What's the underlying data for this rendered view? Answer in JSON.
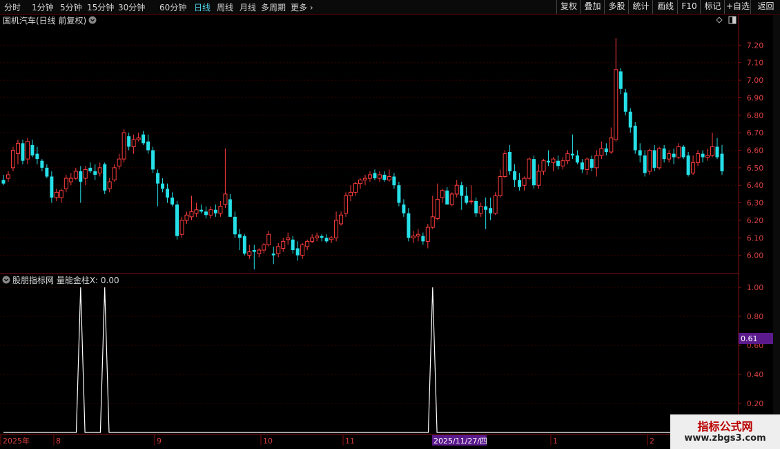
{
  "toolbar": {
    "periods": [
      "分时",
      "1分钟",
      "5分钟",
      "15分钟",
      "30分钟",
      "60分钟",
      "日线",
      "周线",
      "月线",
      "多周期",
      "更多"
    ],
    "active_period": "日线",
    "right_buttons": [
      "复权",
      "叠加",
      "多股",
      "统计",
      "画线",
      "F10",
      "标记",
      "+自选",
      "返回"
    ]
  },
  "main_panel": {
    "title": "国机汽车(日线 前复权)"
  },
  "indicator_panel": {
    "title": "股朋指标网 量能金柱X: 0.00",
    "cursor_value": "0.61"
  },
  "date_axis": {
    "labels": [
      "2025年",
      "8",
      "9",
      "10",
      "11",
      "2025/11/27/四",
      "1",
      "2"
    ]
  },
  "colors": {
    "up": "#ff3d3d",
    "down": "#26e0e8",
    "grid": "#3a0000",
    "axis_text": "#d84040",
    "highlight": "#5a1a8c"
  },
  "watermark": {
    "line1": "指标公式网",
    "line2": "www.zbgs3.com"
  },
  "chart_data": [
    {
      "type": "candlestick",
      "title": "国机汽车(日线 前复权)",
      "ylim": [
        5.9,
        7.3
      ],
      "yticks": [
        6.0,
        6.1,
        6.2,
        6.3,
        6.4,
        6.5,
        6.6,
        6.7,
        6.8,
        6.9,
        7.0,
        7.1,
        7.2
      ],
      "candles": [
        [
          6.43,
          6.46,
          6.4,
          6.41
        ],
        [
          6.44,
          6.48,
          6.42,
          6.46
        ],
        [
          6.5,
          6.62,
          6.48,
          6.6
        ],
        [
          6.58,
          6.66,
          6.52,
          6.64
        ],
        [
          6.64,
          6.66,
          6.52,
          6.54
        ],
        [
          6.55,
          6.67,
          6.52,
          6.65
        ],
        [
          6.63,
          6.66,
          6.56,
          6.57
        ],
        [
          6.58,
          6.62,
          6.52,
          6.55
        ],
        [
          6.54,
          6.55,
          6.48,
          6.5
        ],
        [
          6.5,
          6.52,
          6.44,
          6.45
        ],
        [
          6.45,
          6.48,
          6.3,
          6.33
        ],
        [
          6.33,
          6.38,
          6.31,
          6.36
        ],
        [
          6.33,
          6.38,
          6.3,
          6.37
        ],
        [
          6.38,
          6.46,
          6.36,
          6.44
        ],
        [
          6.42,
          6.47,
          6.4,
          6.44
        ],
        [
          6.44,
          6.5,
          6.43,
          6.48
        ],
        [
          6.48,
          6.51,
          6.3,
          6.42
        ],
        [
          6.44,
          6.51,
          6.4,
          6.49
        ],
        [
          6.5,
          6.53,
          6.47,
          6.48
        ],
        [
          6.48,
          6.52,
          6.43,
          6.46
        ],
        [
          6.47,
          6.53,
          6.45,
          6.5
        ],
        [
          6.52,
          6.53,
          6.35,
          6.37
        ],
        [
          6.38,
          6.44,
          6.36,
          6.42
        ],
        [
          6.43,
          6.52,
          6.42,
          6.5
        ],
        [
          6.51,
          6.58,
          6.49,
          6.55
        ],
        [
          6.55,
          6.72,
          6.53,
          6.7
        ],
        [
          6.68,
          6.7,
          6.6,
          6.62
        ],
        [
          6.62,
          6.69,
          6.58,
          6.66
        ],
        [
          6.66,
          6.7,
          6.65,
          6.67
        ],
        [
          6.69,
          6.71,
          6.63,
          6.64
        ],
        [
          6.65,
          6.69,
          6.58,
          6.6
        ],
        [
          6.6,
          6.62,
          6.47,
          6.49
        ],
        [
          6.47,
          6.49,
          6.28,
          6.41
        ],
        [
          6.41,
          6.44,
          6.36,
          6.38
        ],
        [
          6.38,
          6.41,
          6.3,
          6.33
        ],
        [
          6.33,
          6.36,
          6.28,
          6.29
        ],
        [
          6.29,
          6.31,
          6.09,
          6.11
        ],
        [
          6.12,
          6.22,
          6.1,
          6.2
        ],
        [
          6.2,
          6.25,
          6.18,
          6.23
        ],
        [
          6.22,
          6.34,
          6.2,
          6.25
        ],
        [
          6.24,
          6.3,
          6.22,
          6.26
        ],
        [
          6.26,
          6.29,
          6.24,
          6.25
        ],
        [
          6.25,
          6.28,
          6.21,
          6.23
        ],
        [
          6.23,
          6.28,
          6.21,
          6.26
        ],
        [
          6.26,
          6.29,
          6.22,
          6.24
        ],
        [
          6.24,
          6.31,
          6.22,
          6.28
        ],
        [
          6.29,
          6.61,
          6.27,
          6.35
        ],
        [
          6.32,
          6.35,
          6.22,
          6.22
        ],
        [
          6.22,
          6.25,
          6.1,
          6.12
        ],
        [
          6.12,
          6.15,
          6.03,
          6.1
        ],
        [
          6.11,
          6.12,
          6.0,
          6.01
        ],
        [
          6.0,
          6.06,
          5.98,
          6.02
        ],
        [
          6.03,
          6.06,
          5.92,
          6.02
        ],
        [
          6.01,
          6.04,
          5.99,
          6.03
        ],
        [
          6.03,
          6.07,
          6.01,
          6.06
        ],
        [
          6.06,
          6.14,
          6.05,
          6.12
        ],
        [
          6.01,
          6.05,
          5.95,
          6.0
        ],
        [
          6.01,
          6.07,
          5.99,
          6.05
        ],
        [
          6.04,
          6.1,
          6.02,
          6.08
        ],
        [
          6.09,
          6.13,
          6.06,
          6.1
        ],
        [
          6.09,
          6.11,
          6.01,
          6.03
        ],
        [
          6.04,
          6.08,
          5.97,
          6.0
        ],
        [
          6.0,
          6.07,
          5.98,
          6.06
        ],
        [
          6.05,
          6.09,
          6.03,
          6.08
        ],
        [
          6.08,
          6.12,
          6.07,
          6.1
        ],
        [
          6.1,
          6.13,
          6.08,
          6.11
        ],
        [
          6.11,
          6.12,
          6.08,
          6.1
        ],
        [
          6.1,
          6.12,
          6.07,
          6.08
        ],
        [
          6.09,
          6.11,
          6.07,
          6.1
        ],
        [
          6.1,
          6.25,
          6.08,
          6.2
        ],
        [
          6.18,
          6.25,
          6.17,
          6.23
        ],
        [
          6.24,
          6.36,
          6.22,
          6.34
        ],
        [
          6.34,
          6.4,
          6.31,
          6.36
        ],
        [
          6.36,
          6.42,
          6.34,
          6.41
        ],
        [
          6.41,
          6.44,
          6.38,
          6.43
        ],
        [
          6.43,
          6.46,
          6.4,
          6.44
        ],
        [
          6.44,
          6.48,
          6.42,
          6.46
        ],
        [
          6.47,
          6.49,
          6.43,
          6.44
        ],
        [
          6.44,
          6.48,
          6.42,
          6.46
        ],
        [
          6.46,
          6.48,
          6.42,
          6.43
        ],
        [
          6.43,
          6.49,
          6.42,
          6.45
        ],
        [
          6.45,
          6.47,
          6.38,
          6.4
        ],
        [
          6.4,
          6.42,
          6.28,
          6.3
        ],
        [
          6.29,
          6.32,
          6.22,
          6.24
        ],
        [
          6.24,
          6.27,
          6.08,
          6.1
        ],
        [
          6.1,
          6.14,
          6.07,
          6.11
        ],
        [
          6.11,
          6.15,
          6.08,
          6.12
        ],
        [
          6.11,
          6.13,
          6.06,
          6.08
        ],
        [
          6.08,
          6.18,
          6.04,
          6.16
        ],
        [
          6.16,
          6.34,
          6.15,
          6.22
        ],
        [
          6.21,
          6.41,
          6.2,
          6.32
        ],
        [
          6.33,
          6.38,
          6.3,
          6.37
        ],
        [
          6.37,
          6.39,
          6.29,
          6.29
        ],
        [
          6.29,
          6.36,
          6.28,
          6.35
        ],
        [
          6.35,
          6.43,
          6.33,
          6.4
        ],
        [
          6.4,
          6.42,
          6.26,
          6.34
        ],
        [
          6.34,
          6.39,
          6.29,
          6.3
        ],
        [
          6.31,
          6.4,
          6.29,
          6.31
        ],
        [
          6.31,
          6.33,
          6.22,
          6.24
        ],
        [
          6.24,
          6.3,
          6.22,
          6.28
        ],
        [
          6.28,
          6.33,
          6.15,
          6.26
        ],
        [
          6.27,
          6.33,
          6.2,
          6.24
        ],
        [
          6.24,
          6.36,
          6.23,
          6.34
        ],
        [
          6.34,
          6.49,
          6.33,
          6.45
        ],
        [
          6.45,
          6.6,
          6.44,
          6.58
        ],
        [
          6.59,
          6.63,
          6.46,
          6.48
        ],
        [
          6.48,
          6.52,
          6.39,
          6.43
        ],
        [
          6.43,
          6.47,
          6.37,
          6.39
        ],
        [
          6.4,
          6.45,
          6.37,
          6.44
        ],
        [
          6.44,
          6.56,
          6.43,
          6.55
        ],
        [
          6.55,
          6.57,
          6.38,
          6.4
        ],
        [
          6.4,
          6.52,
          6.38,
          6.48
        ],
        [
          6.48,
          6.55,
          6.46,
          6.54
        ],
        [
          6.54,
          6.6,
          6.51,
          6.53
        ],
        [
          6.53,
          6.56,
          6.48,
          6.55
        ],
        [
          6.54,
          6.57,
          6.49,
          6.51
        ],
        [
          6.51,
          6.56,
          6.49,
          6.54
        ],
        [
          6.54,
          6.6,
          6.52,
          6.58
        ],
        [
          6.58,
          6.69,
          6.55,
          6.57
        ],
        [
          6.57,
          6.6,
          6.52,
          6.53
        ],
        [
          6.53,
          6.55,
          6.47,
          6.49
        ],
        [
          6.49,
          6.56,
          6.46,
          6.55
        ],
        [
          6.55,
          6.57,
          6.48,
          6.5
        ],
        [
          6.5,
          6.6,
          6.45,
          6.57
        ],
        [
          6.57,
          6.65,
          6.55,
          6.61
        ],
        [
          6.61,
          6.64,
          6.57,
          6.59
        ],
        [
          6.59,
          6.73,
          6.58,
          6.67
        ],
        [
          6.66,
          7.24,
          6.65,
          7.06
        ],
        [
          7.05,
          7.07,
          6.92,
          6.95
        ],
        [
          6.93,
          6.95,
          6.8,
          6.82
        ],
        [
          6.82,
          6.84,
          6.7,
          6.73
        ],
        [
          6.74,
          6.76,
          6.58,
          6.6
        ],
        [
          6.6,
          6.64,
          6.53,
          6.57
        ],
        [
          6.57,
          6.6,
          6.45,
          6.47
        ],
        [
          6.48,
          6.61,
          6.46,
          6.6
        ],
        [
          6.6,
          6.63,
          6.48,
          6.5
        ],
        [
          6.5,
          6.62,
          6.49,
          6.61
        ],
        [
          6.61,
          6.63,
          6.53,
          6.55
        ],
        [
          6.55,
          6.6,
          6.53,
          6.58
        ],
        [
          6.58,
          6.61,
          6.52,
          6.56
        ],
        [
          6.56,
          6.64,
          6.55,
          6.62
        ],
        [
          6.62,
          6.63,
          6.55,
          6.56
        ],
        [
          6.57,
          6.59,
          6.45,
          6.46
        ],
        [
          6.47,
          6.57,
          6.46,
          6.53
        ],
        [
          6.53,
          6.6,
          6.51,
          6.58
        ],
        [
          6.58,
          6.6,
          6.53,
          6.56
        ],
        [
          6.56,
          6.61,
          6.54,
          6.57
        ],
        [
          6.57,
          6.7,
          6.56,
          6.62
        ],
        [
          6.62,
          6.67,
          6.55,
          6.56
        ],
        [
          6.58,
          6.63,
          6.46,
          6.48
        ]
      ]
    },
    {
      "type": "line",
      "title": "股朋指标网 量能金柱X: 0.00",
      "ylim": [
        0,
        1.05
      ],
      "yticks": [
        0.2,
        0.4,
        0.6,
        0.8,
        1.0
      ],
      "spikes": [
        {
          "index": 16,
          "value": 1.0
        },
        {
          "index": 21,
          "value": 1.0
        },
        {
          "index": 89,
          "value": 1.0
        }
      ]
    }
  ]
}
